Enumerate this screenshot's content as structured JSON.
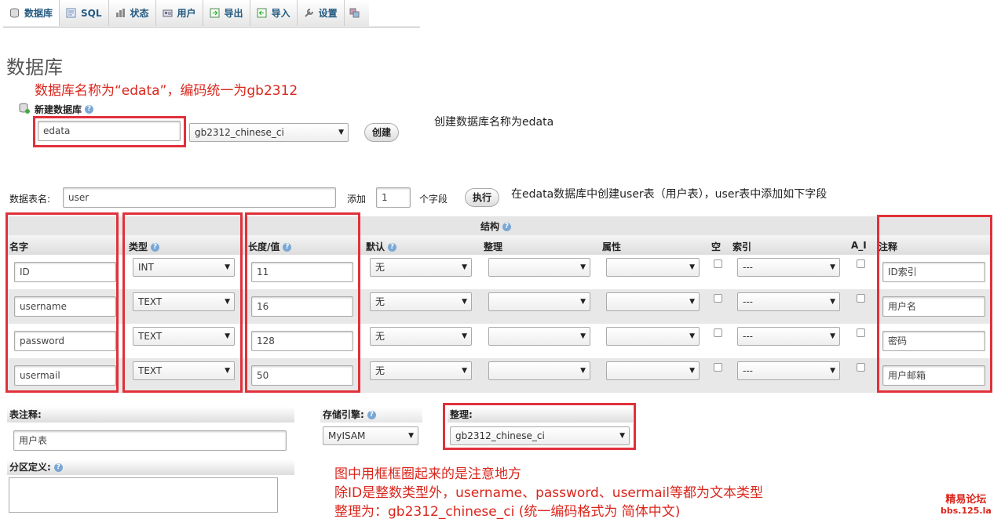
{
  "tabs": [
    {
      "label": "数据库",
      "icon": "database-icon"
    },
    {
      "label": "SQL",
      "icon": "sql-icon"
    },
    {
      "label": "状态",
      "icon": "status-icon"
    },
    {
      "label": "用户",
      "icon": "users-icon"
    },
    {
      "label": "导出",
      "icon": "export-icon"
    },
    {
      "label": "导入",
      "icon": "import-icon"
    },
    {
      "label": "设置",
      "icon": "settings-icon"
    }
  ],
  "page_title": "数据库",
  "annotations": {
    "db_name_note": "数据库名称为“edata”，编码统一为gb2312",
    "create_db_note": "创建数据库名称为edata",
    "create_table_note": "在edata数据库中创建user表（用户表），user表中添加如下字段",
    "bottom_note_1": "图中用框框圈起来的是注意地方",
    "bottom_note_2": "除ID是整数类型外，username、password、usermail等都为文本类型",
    "bottom_note_3": "整理为：gb2312_chinese_ci (统一编码格式为 简体中文)"
  },
  "new_db": {
    "label": "新建数据库",
    "name_value": "edata",
    "collation": "gb2312_chinese_ci",
    "create_button": "创建"
  },
  "table_form": {
    "table_name_label": "数据表名:",
    "table_name_value": "user",
    "add_label": "添加",
    "add_count": "1",
    "fields_label": "个字段",
    "go_button": "执行"
  },
  "structure": {
    "group_label": "结构",
    "columns": {
      "name": "名字",
      "type": "类型",
      "length": "长度/值",
      "default": "默认",
      "collation": "整理",
      "attributes": "属性",
      "null": "空",
      "index": "索引",
      "ai": "A_I",
      "comment": "注释"
    },
    "rows": [
      {
        "name": "ID",
        "type": "INT",
        "length": "11",
        "default": "无",
        "collation": "",
        "attributes": "",
        "index": "---",
        "comment": "ID索引"
      },
      {
        "name": "username",
        "type": "TEXT",
        "length": "16",
        "default": "无",
        "collation": "",
        "attributes": "",
        "index": "---",
        "comment": "用户名"
      },
      {
        "name": "password",
        "type": "TEXT",
        "length": "128",
        "default": "无",
        "collation": "",
        "attributes": "",
        "index": "---",
        "comment": "密码"
      },
      {
        "name": "usermail",
        "type": "TEXT",
        "length": "50",
        "default": "无",
        "collation": "",
        "attributes": "",
        "index": "---",
        "comment": "用户邮箱"
      }
    ]
  },
  "table_comment": {
    "label": "表注释:",
    "value": "用户表"
  },
  "storage_engine": {
    "label": "存储引擎:",
    "value": "MyISAM"
  },
  "table_collation": {
    "label": "整理:",
    "value": "gb2312_chinese_ci"
  },
  "partition": {
    "label": "分区定义:"
  },
  "watermark": {
    "line1": "精易论坛",
    "line2": "bbs.125.la"
  },
  "colors": {
    "annotation_red": "#d9261c",
    "box_red": "#e0313b",
    "header_gray": "#e5e5e5",
    "row_alt": "#e8e8e8"
  }
}
